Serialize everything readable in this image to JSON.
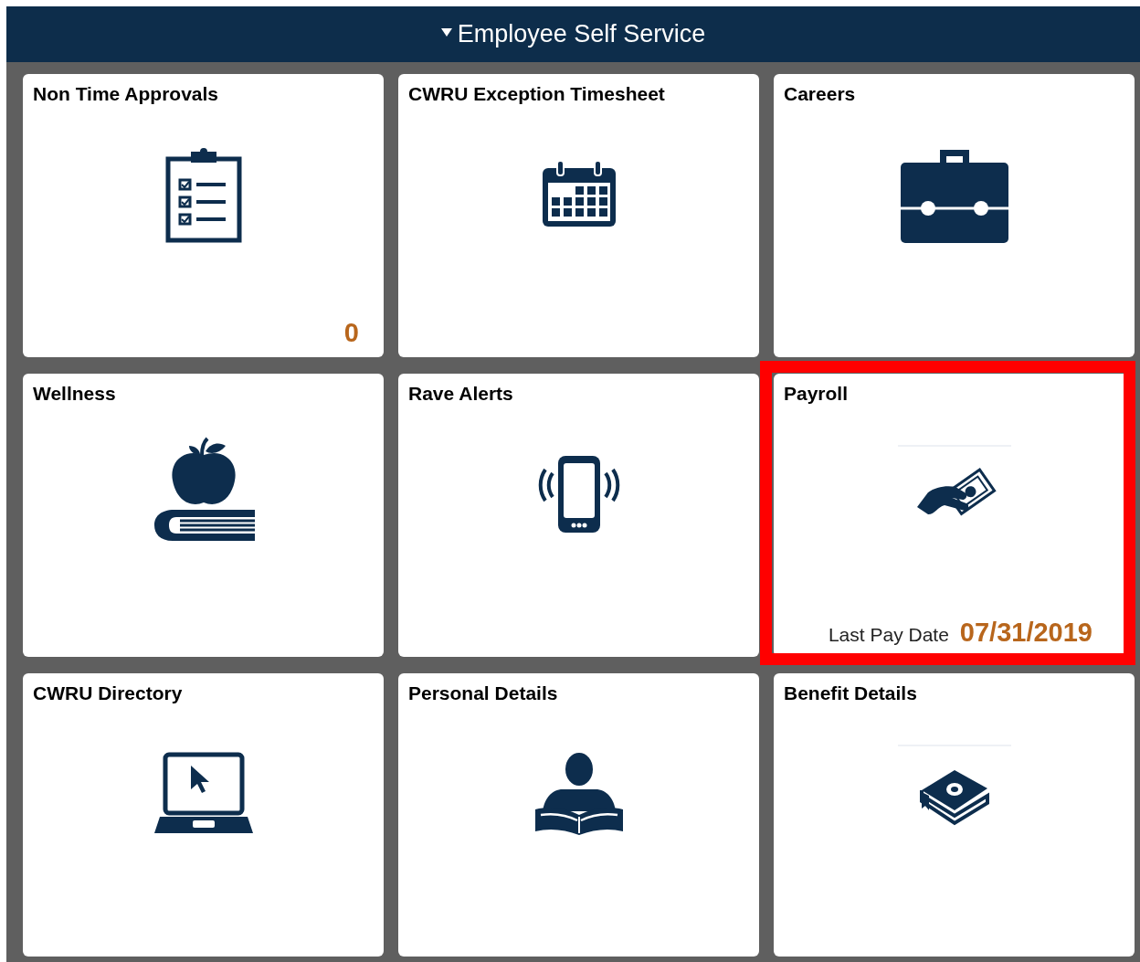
{
  "header": {
    "title": "Employee Self Service",
    "expanded": true
  },
  "tiles": [
    {
      "title": "Non Time Approvals",
      "count": "0",
      "highlighted": false
    },
    {
      "title": "CWRU Exception Timesheet",
      "highlighted": false
    },
    {
      "title": "Careers",
      "highlighted": false
    },
    {
      "title": "Wellness",
      "highlighted": false
    },
    {
      "title": "Rave Alerts",
      "highlighted": false
    },
    {
      "title": "Payroll",
      "footer": {
        "label": "Last Pay Date",
        "value": "07/31/2019"
      },
      "highlighted": true
    },
    {
      "title": "CWRU Directory",
      "highlighted": false
    },
    {
      "title": "Personal Details",
      "highlighted": false
    },
    {
      "title": "Benefit Details",
      "highlighted": false
    }
  ]
}
